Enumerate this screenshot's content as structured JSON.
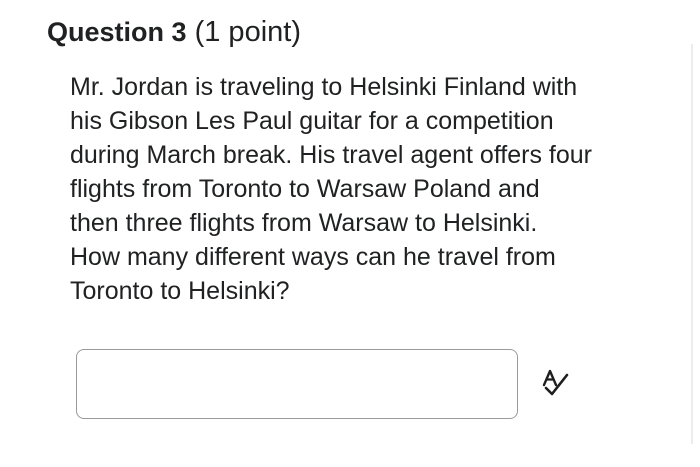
{
  "question": {
    "title": "Question 3",
    "points": "(1 point)",
    "body_lines": [
      "Mr. Jordan is traveling to Helsinki Finland with",
      "his Gibson Les Paul guitar for a competition",
      "during March break. His travel agent offers four",
      "flights from Toronto to Warsaw Poland and",
      "then three flights from Warsaw to Helsinki.",
      "How many different ways can he travel from",
      "Toronto to Helsinki?"
    ]
  },
  "answer": {
    "value": "",
    "placeholder": ""
  },
  "tools": {
    "spellcheck_icon": "spellcheck-icon"
  },
  "colors": {
    "text": "#202122",
    "input_border": "#9a9a9a",
    "icon": "#1f1f1f"
  }
}
